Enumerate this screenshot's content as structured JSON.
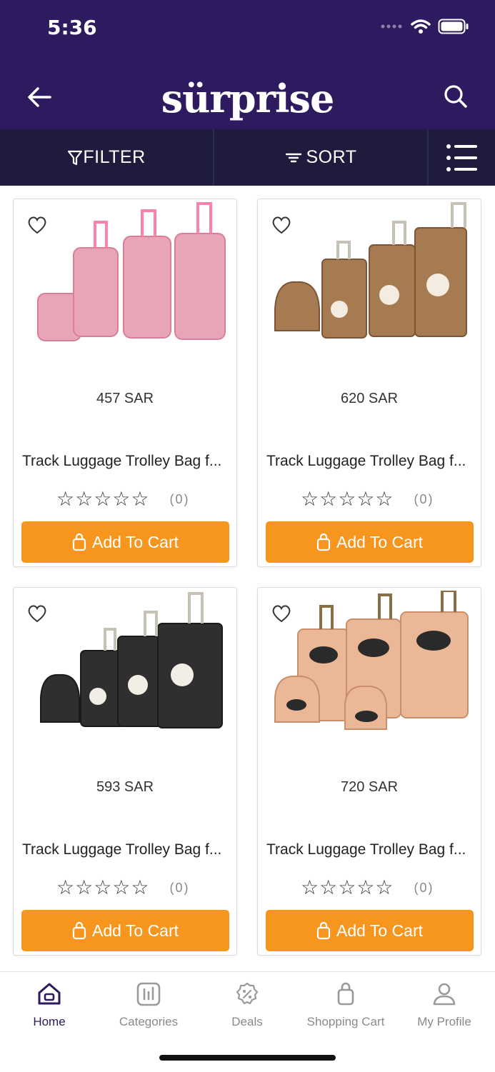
{
  "status_bar": {
    "time": "5:36"
  },
  "header": {
    "logo": "sürprise"
  },
  "toolbar": {
    "filter_label": "FILTER",
    "sort_label": "SORT"
  },
  "products": [
    {
      "price": "457 SAR",
      "title": "Track Luggage Trolley Bag f...",
      "rating_count": "(0)",
      "cart_label": "Add To Cart",
      "color": "#e8a5b8",
      "image_label": "pink-luggage-set"
    },
    {
      "price": "620 SAR",
      "title": "Track Luggage Trolley Bag f...",
      "rating_count": "(0)",
      "cart_label": "Add To Cart",
      "color": "#a77b52",
      "image_label": "brown-luggage-set"
    },
    {
      "price": "593 SAR",
      "title": "Track Luggage Trolley Bag f...",
      "rating_count": "(0)",
      "cart_label": "Add To Cart",
      "color": "#2f2f2f",
      "image_label": "black-luggage-set"
    },
    {
      "price": "720 SAR",
      "title": "Track Luggage Trolley Bag f...",
      "rating_count": "(0)",
      "cart_label": "Add To Cart",
      "color": "#eab896",
      "image_label": "beige-luggage-set"
    }
  ],
  "bottom_nav": {
    "home": "Home",
    "categories": "Categories",
    "deals": "Deals",
    "cart": "Shopping Cart",
    "profile": "My Profile"
  },
  "colors": {
    "brand": "#2e1a5e",
    "toolbar": "#1e1b3d",
    "accent": "#f7961f"
  }
}
